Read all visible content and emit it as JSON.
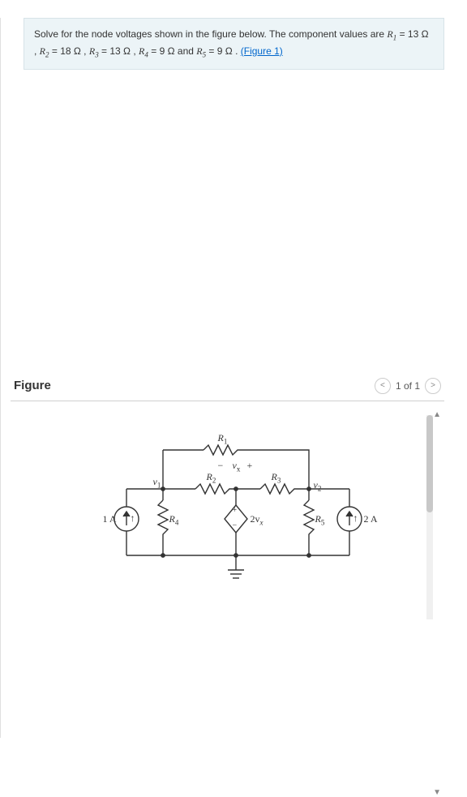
{
  "problem": {
    "intro": "Solve for the node voltages shown in the figure below. The component values are ",
    "R1_label": "R",
    "R1_sub": "1",
    "R1_val": " = 13 Ω",
    "R2_label": "R",
    "R2_sub": "2",
    "R2_val": " = 18 Ω",
    "R3_label": "R",
    "R3_sub": "3",
    "R3_val": " = 13 Ω",
    "R4_label": "R",
    "R4_sub": "4",
    "R4_val": " = 9 Ω",
    "R5_label": "R",
    "R5_sub": "5",
    "R5_val": " = 9 Ω",
    "and": " and ",
    "sep": " , ",
    "period": " . ",
    "figure_link": "(Figure 1)"
  },
  "figure": {
    "title": "Figure",
    "page": "1 of 1",
    "prev": "<",
    "next": ">"
  },
  "circuit": {
    "I1": "1 A",
    "I2": "2 A",
    "R1": "R",
    "R1s": "1",
    "R2": "R",
    "R2s": "2",
    "R3": "R",
    "R3s": "3",
    "R4": "R",
    "R4s": "4",
    "R5": "R",
    "R5s": "5",
    "v1": "v",
    "v1s": "1",
    "v2": "v",
    "v2s": "2",
    "vx": "v",
    "vxs": "x",
    "dep": "2v",
    "deps": "x",
    "plus": "+",
    "minus": "−",
    "arrow_up": "↑"
  }
}
